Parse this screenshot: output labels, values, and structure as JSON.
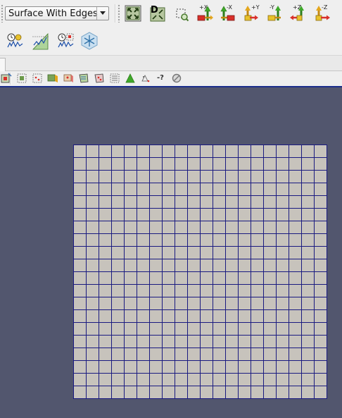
{
  "representation": {
    "selected": "Surface With Edges"
  },
  "camera_toolbar": {
    "buttons": [
      {
        "icon": "reset-camera-icon"
      },
      {
        "icon": "zoom-to-data-icon",
        "badge": "D"
      },
      {
        "icon": "zoom-to-box-icon"
      }
    ],
    "axis_buttons": [
      {
        "label": "+X",
        "icon": "view-plus-x-icon"
      },
      {
        "label": "-X",
        "icon": "view-minus-x-icon"
      },
      {
        "label": "+Y",
        "icon": "view-plus-y-icon"
      },
      {
        "label": "-Y",
        "icon": "view-minus-y-icon"
      },
      {
        "label": "+Z",
        "icon": "view-plus-z-icon"
      },
      {
        "label": "-Z",
        "icon": "view-minus-z-icon"
      }
    ]
  },
  "time_toolbar": {
    "buttons": [
      {
        "icon": "plot-over-time-icon"
      },
      {
        "icon": "plot-over-line-icon"
      },
      {
        "icon": "plot-selection-over-time-icon"
      },
      {
        "icon": "3d-glyph-icon"
      }
    ]
  },
  "selection_toolbar": {
    "buttons": [
      {
        "icon": "interactive-select-icon"
      },
      {
        "icon": "select-cells-on-icon"
      },
      {
        "icon": "select-points-on-icon"
      },
      {
        "icon": "select-cells-through-icon"
      },
      {
        "icon": "select-points-through-icon"
      },
      {
        "icon": "select-cells-polygon-icon"
      },
      {
        "icon": "select-points-polygon-icon"
      },
      {
        "icon": "select-block-icon"
      },
      {
        "icon": "grow-selection-icon"
      },
      {
        "icon": "shrink-selection-icon"
      }
    ],
    "hover_label": "-?",
    "clear_icon": "clear-selection-icon"
  },
  "viewport": {
    "background": "#52566e",
    "mesh_fill": "#c7c3bc",
    "edge_color": "#1a1a80",
    "grid_cells": 20
  }
}
